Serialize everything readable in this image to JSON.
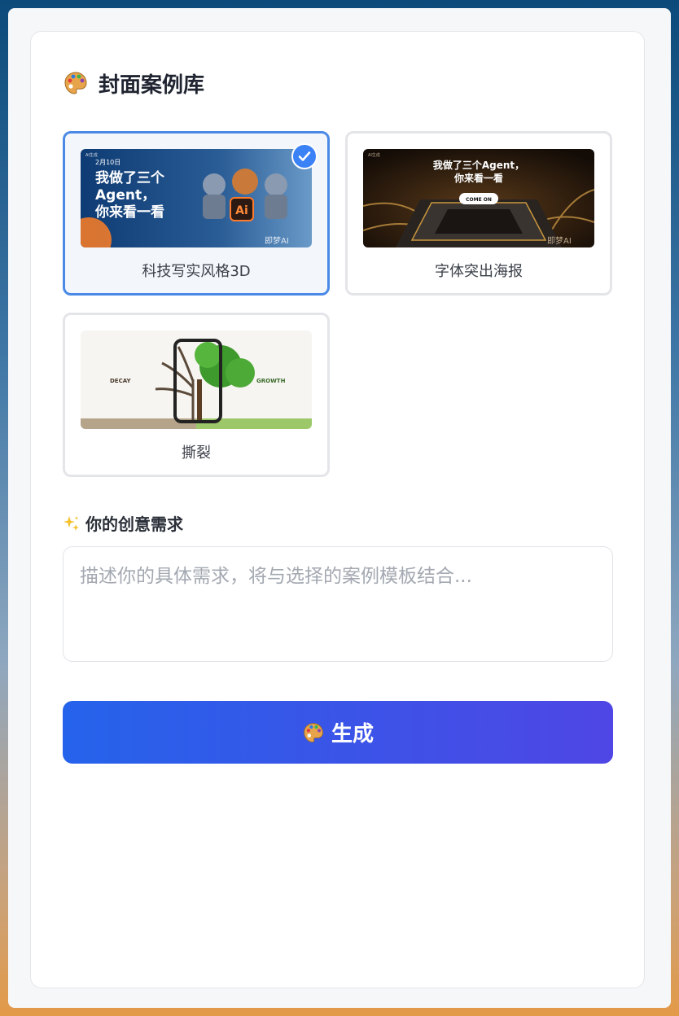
{
  "header": {
    "icon": "palette-icon",
    "title": "封面案例库"
  },
  "cases": [
    {
      "label": "科技写实风格3D",
      "selected": true,
      "thumb": {
        "corner_tag": "AI生成",
        "date": "2月10日",
        "headline": "我做了三个",
        "headline2": "Agent，",
        "headline3": "你来看一看",
        "badge": "Ai",
        "brand": "即梦AI"
      }
    },
    {
      "label": "字体突出海报",
      "selected": false,
      "thumb": {
        "corner_tag": "AI生成",
        "headline": "我做了三个Agent，",
        "headline2": "你来看一看",
        "button": "COME ON",
        "brand": "即梦AI"
      }
    },
    {
      "label": "撕裂",
      "selected": false,
      "thumb": {
        "left_word": "DECAY",
        "right_word": "GROWTH"
      }
    }
  ],
  "prompt": {
    "icon": "sparkles-icon",
    "label": "你的创意需求",
    "placeholder": "描述你的具体需求，将与选择的案例模板结合...",
    "value": ""
  },
  "generate": {
    "icon": "palette-icon",
    "label": "生成"
  },
  "colors": {
    "accent": "#3b82f6",
    "button_start": "#2563eb",
    "button_end": "#4f46e5"
  }
}
